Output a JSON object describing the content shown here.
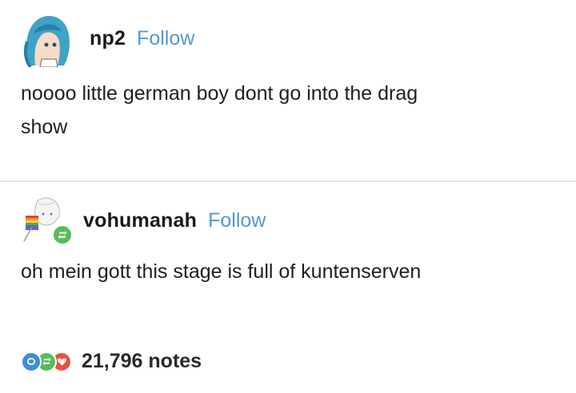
{
  "post1": {
    "avatar_icon": "anime-avatar-blue-hair",
    "username": "np2",
    "follow_label": "Follow",
    "text_line1": "noooo little german boy dont go into the drag",
    "text_line2": "show"
  },
  "post2": {
    "avatar_icon": "anime-avatar-sketch",
    "reblog_badge_icon": "reblog-icon",
    "username": "vohumanah",
    "follow_label": "Follow",
    "text": "oh mein gott this stage is full of kuntenserven"
  },
  "notes": {
    "icons": [
      "reply-icon",
      "reblog-icon",
      "like-icon"
    ],
    "count_text": "21,796 notes"
  },
  "colors": {
    "follow_blue": "#4f9ad6",
    "reply_blue": "#3b8de0",
    "reblog_green": "#56bc5a",
    "like_red": "#e8523f",
    "divider": "#e3e3e3"
  }
}
